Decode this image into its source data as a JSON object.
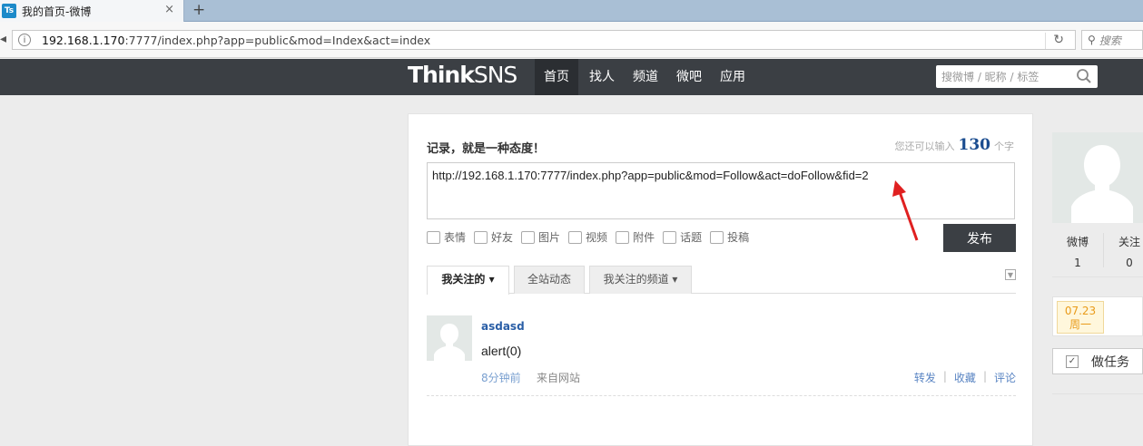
{
  "browser": {
    "tab_icon": "Ts",
    "tab_title": "我的首页-微博",
    "tab_close": "×",
    "new_tab": "+",
    "url_host": "192.168.1.170",
    "url_rest": ":7777/index.php?app=public&mod=Index&act=index",
    "search_placeholder": "搜索"
  },
  "site": {
    "logo_bold": "Think",
    "logo_light": "SNS",
    "nav": [
      "首页",
      "找人",
      "频道",
      "微吧",
      "应用"
    ],
    "search_placeholder": "搜微博 / 昵称 / 标签"
  },
  "compose": {
    "title": "记录，就是一种态度！",
    "counter_prefix": "您还可以输入",
    "counter_value": "130",
    "counter_suffix": "个字",
    "text": "http://192.168.1.170:7777/index.php?app=public&mod=Follow&act=doFollow&fid=2",
    "tools": [
      "表情",
      "好友",
      "图片",
      "视频",
      "附件",
      "话题",
      "投稿"
    ],
    "publish_label": "发布"
  },
  "feed_tabs": [
    "我关注的 ▾",
    "全站动态",
    "我关注的频道 ▾"
  ],
  "feed": [
    {
      "user": "asdasd",
      "text": "alert(0)",
      "time": "8分钟前",
      "from": "来自网站",
      "actions": [
        "转发",
        "收藏",
        "评论"
      ]
    }
  ],
  "sidebar": {
    "stats": [
      {
        "label": "微博",
        "value": "1"
      },
      {
        "label": "关注",
        "value": "0"
      }
    ],
    "date": "07.23",
    "weekday": "周一",
    "task_label": "做任务"
  },
  "colors": {
    "nav_bg": "#3b3f44",
    "link": "#2a5ea6",
    "annotation_arrow": "#e02020"
  }
}
